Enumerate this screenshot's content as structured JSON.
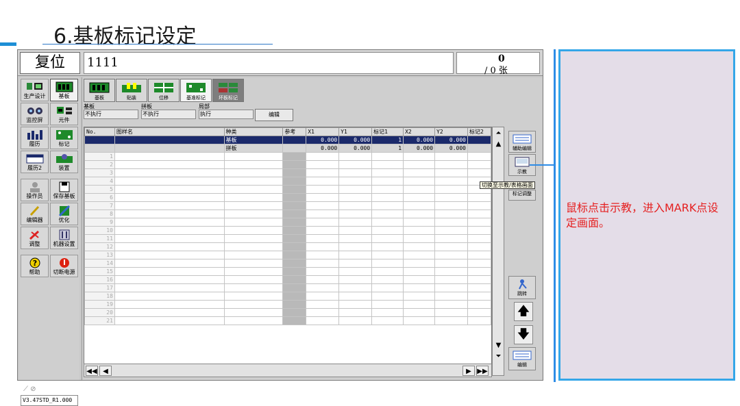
{
  "slide": {
    "title": "6.基板标记设定",
    "note": "鼠标点击示教，进入MARK点设定画面。"
  },
  "topbar": {
    "reset_label": "复位",
    "program_name": "1111",
    "counter_value": "0",
    "counter_total": "/ 0 张"
  },
  "sidebar": {
    "items": [
      {
        "label": "生产设计",
        "icon": "production-icon"
      },
      {
        "label": "基板",
        "icon": "board-icon"
      },
      {
        "label": "监控屏",
        "icon": "monitor-icon"
      },
      {
        "label": "元件",
        "icon": "component-icon"
      },
      {
        "label": "履历",
        "icon": "history-icon"
      },
      {
        "label": "标记",
        "icon": "mark-icon"
      },
      {
        "label": "履历2",
        "icon": "history2-icon"
      },
      {
        "label": "装置",
        "icon": "device-icon"
      },
      {
        "label": "操作员",
        "icon": "operator-icon"
      },
      {
        "label": "保存基板",
        "icon": "save-icon"
      },
      {
        "label": "编辑器",
        "icon": "editor-icon"
      },
      {
        "label": "优化",
        "icon": "optimize-icon"
      },
      {
        "label": "调整",
        "icon": "adjust-icon"
      },
      {
        "label": "机器设置",
        "icon": "machine-settings-icon"
      },
      {
        "label": "帮助",
        "icon": "help-icon"
      },
      {
        "label": "切断电源",
        "icon": "power-icon"
      }
    ],
    "version": "V3.47STD_R1.000"
  },
  "tabs": [
    {
      "label": "基板"
    },
    {
      "label": "贴装"
    },
    {
      "label": "位移"
    },
    {
      "label": "基准标记"
    },
    {
      "label": "坏板标记"
    }
  ],
  "exec": {
    "board_label": "基板",
    "board_value": "不执行",
    "panel_label": "拼板",
    "panel_value": "不执行",
    "local_label": "局部",
    "local_value": "执行",
    "edit_button": "编辑"
  },
  "table": {
    "headers": [
      "No.",
      "图样名",
      "种类",
      "参考",
      "X1",
      "Y1",
      "标记1",
      "X2",
      "Y2",
      "标记2"
    ],
    "rows": [
      {
        "no": "",
        "pattern": "",
        "type": "基板",
        "ref": "",
        "x1": "0.000",
        "y1": "0.000",
        "m1": "1",
        "x2": "0.000",
        "y2": "0.000",
        "m2": ""
      },
      {
        "no": "",
        "pattern": "",
        "type": "拼板",
        "ref": "",
        "x1": "0.000",
        "y1": "0.000",
        "m1": "1",
        "x2": "0.000",
        "y2": "0.000",
        "m2": ""
      }
    ],
    "empty_rows": [
      "1",
      "2",
      "3",
      "4",
      "5",
      "6",
      "7",
      "8",
      "9",
      "10",
      "11",
      "12",
      "13",
      "14",
      "15",
      "16",
      "17",
      "18",
      "19",
      "20",
      "21"
    ]
  },
  "right_buttons": {
    "aux_edit": "辅助编辑",
    "teach": "示教",
    "tooltip": "切换至示教/表格画面",
    "mark_adjust": "标记调整",
    "skip": "跳转",
    "edit": "编辑"
  },
  "colors": {
    "selected_row": "#1b2a6b",
    "accent_blue": "#2d8ce6",
    "note_red": "#e51f1f"
  }
}
